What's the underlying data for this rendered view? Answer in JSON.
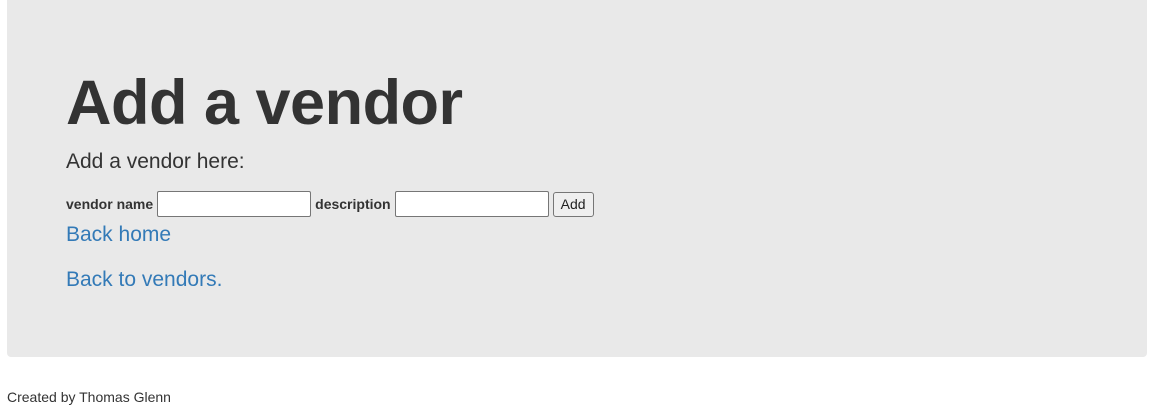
{
  "header": {
    "title": "Add a vendor",
    "subtitle": "Add a vendor here:"
  },
  "form": {
    "vendor_name_label": "vendor name",
    "vendor_name_value": "",
    "description_label": "description",
    "description_value": "",
    "submit_label": "Add"
  },
  "links": {
    "back_home": "Back home",
    "back_to_vendors": "Back to vendors."
  },
  "footer": {
    "credit": "Created by Thomas Glenn"
  },
  "colors": {
    "jumbotron_bg": "#e9e9e9",
    "link": "#337ab7",
    "text": "#333333"
  }
}
